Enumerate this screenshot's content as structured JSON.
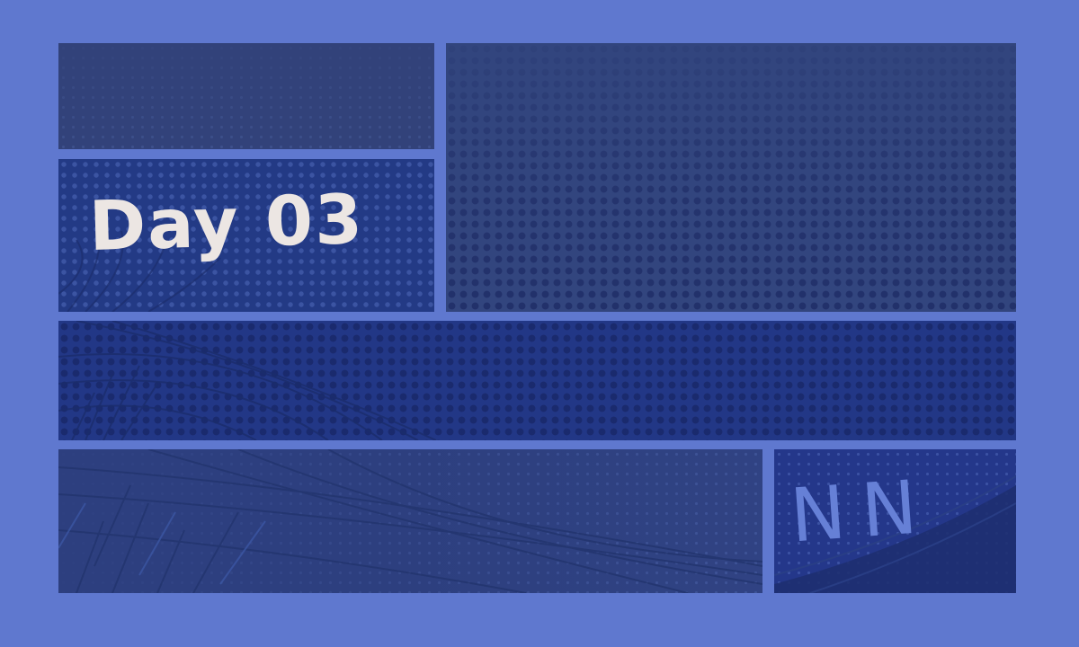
{
  "canvas": {
    "background_color": "#5f78cf"
  },
  "panels": {
    "day_panel": {
      "text": "Day 03",
      "text_color": "#ece6e3"
    },
    "corner_panel": {
      "text": "NN",
      "text_color": "#6680d6"
    }
  },
  "palette": {
    "panel_dark": "#32427a",
    "panel_deep": "#223786",
    "gutter": "#5f78cf"
  }
}
